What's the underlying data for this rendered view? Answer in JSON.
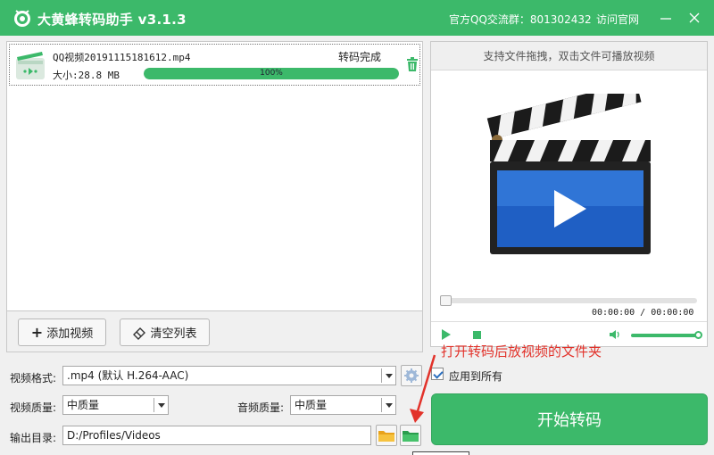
{
  "window": {
    "title": "大黄蜂转码助手 v3.1.3",
    "qq_group": "官方QQ交流群：801302432",
    "visit_site": "访问官网"
  },
  "file_list": {
    "items": [
      {
        "name": "QQ视频20191115181612.mp4",
        "size": "大小:28.8 MB",
        "status": "转码完成",
        "progress_percent": 100,
        "progress_label": "100%"
      }
    ]
  },
  "toolbar": {
    "add_video": "添加视频",
    "clear_list": "清空列表"
  },
  "preview": {
    "hint": "支持文件拖拽，双击文件可播放视频",
    "time": "00:00:00 / 00:00:00",
    "seek_fraction": 0,
    "volume_fraction": 1
  },
  "settings": {
    "format_label": "视频格式:",
    "format_value": ".mp4 (默认 H.264-AAC)",
    "apply_all_label": "应用到所有",
    "apply_all_checked": true,
    "video_quality_label": "视频质量:",
    "video_quality_value": "中质量",
    "audio_quality_label": "音频质量:",
    "audio_quality_value": "中质量",
    "output_dir_label": "输出目录:",
    "output_dir_value": "D:/Profiles/Videos"
  },
  "start_button": "开始转码",
  "annotation": "打开转码后放视频的文件夹",
  "colors": {
    "accent": "#3cb96a",
    "annotation": "#e2322a",
    "clapper_blue": "#1f5fc4"
  }
}
